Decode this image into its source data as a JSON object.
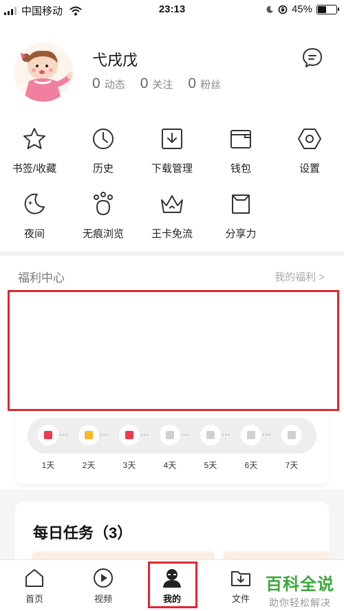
{
  "status_bar": {
    "carrier": "中国移动",
    "time": "23:13",
    "battery": "45%",
    "battery_level": 0.45
  },
  "profile": {
    "username": "弋戌戊",
    "stats": [
      {
        "value": "0",
        "label": "动态"
      },
      {
        "value": "0",
        "label": "关注"
      },
      {
        "value": "0",
        "label": "粉丝"
      }
    ]
  },
  "menu": {
    "row1": [
      {
        "label": "书签/收藏",
        "icon": "star-icon"
      },
      {
        "label": "历史",
        "icon": "clock-icon"
      },
      {
        "label": "下载管理",
        "icon": "download-icon"
      },
      {
        "label": "钱包",
        "icon": "wallet-icon"
      },
      {
        "label": "设置",
        "icon": "hexagon-settings-icon"
      }
    ],
    "row2": [
      {
        "label": "夜间",
        "icon": "moon-icon"
      },
      {
        "label": "无痕浏览",
        "icon": "paw-icon"
      },
      {
        "label": "王卡免流",
        "icon": "crown-icon"
      },
      {
        "label": "分享力",
        "icon": "share-bag-icon"
      }
    ]
  },
  "welfare": {
    "title": "福利中心",
    "link": "我的福利 >",
    "days": [
      "1天",
      "2天",
      "3天",
      "4天",
      "5天",
      "6天",
      "7天"
    ],
    "day_states": [
      "red",
      "yellow",
      "red",
      "gray",
      "gray",
      "gray",
      "gray"
    ]
  },
  "daily_tasks": {
    "title": "每日任务（3）"
  },
  "tabbar": {
    "tabs": [
      {
        "label": "首页",
        "icon": "home-icon"
      },
      {
        "label": "视频",
        "icon": "play-icon"
      },
      {
        "label": "我的",
        "icon": "profile-icon"
      },
      {
        "label": "文件",
        "icon": "folder-download-icon"
      }
    ],
    "active": "我的"
  },
  "watermark": {
    "title": "百科全说",
    "subtitle": "助你轻松解决"
  },
  "colors": {
    "highlight": "#e0262f",
    "badge_red": "#ef3b4d",
    "badge_yellow": "#f9b72a",
    "badge_gray": "#d0d0d0",
    "watermark": "#3aa83a"
  }
}
